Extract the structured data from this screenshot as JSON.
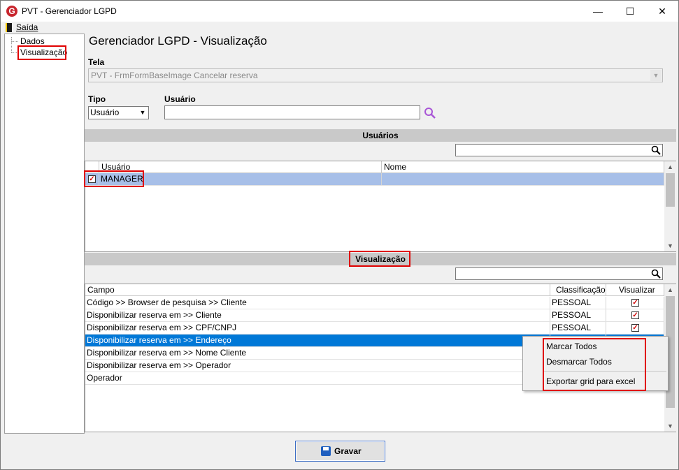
{
  "window": {
    "title": "PVT - Gerenciador LGPD",
    "app_icon": "G",
    "minimize": "—",
    "maximize": "☐",
    "close": "✕"
  },
  "menu": {
    "saida": "Saída"
  },
  "tree": {
    "items": [
      "Dados",
      "Visualização"
    ]
  },
  "heading": "Gerenciador LGPD - Visualização",
  "tela": {
    "label": "Tela",
    "value": "PVT - FrmFormBaseImage Cancelar reserva"
  },
  "tipo": {
    "label": "Tipo",
    "value": "Usuário"
  },
  "usuario": {
    "label": "Usuário",
    "value": ""
  },
  "usuarios_section": {
    "title": "Usuários",
    "search_value": "",
    "columns": [
      "Usuário",
      "Nome"
    ],
    "rows": [
      {
        "checked": true,
        "usuario": "MANAGER",
        "nome": ""
      }
    ]
  },
  "visualizacao_section": {
    "title": "Visualização",
    "search_value": "",
    "columns": [
      "Campo",
      "Classificação",
      "Visualizar"
    ],
    "rows": [
      {
        "campo": "Código >> Browser de pesquisa >> Cliente",
        "classificacao": "PESSOAL",
        "visualizar": true
      },
      {
        "campo": "Disponibilizar reserva em >> Cliente",
        "classificacao": "PESSOAL",
        "visualizar": true
      },
      {
        "campo": "Disponibilizar reserva em >> CPF/CNPJ",
        "classificacao": "PESSOAL",
        "visualizar": true
      },
      {
        "campo": "Disponibilizar reserva em >> Endereço",
        "classificacao": "",
        "visualizar": false
      },
      {
        "campo": "Disponibilizar reserva em >> Nome Cliente",
        "classificacao": "",
        "visualizar": false
      },
      {
        "campo": "Disponibilizar reserva em >> Operador",
        "classificacao": "",
        "visualizar": false
      },
      {
        "campo": "Operador",
        "classificacao": "",
        "visualizar": false
      }
    ]
  },
  "context_menu": {
    "items": [
      "Marcar Todos",
      "Desmarcar Todos",
      "Exportar grid para excel"
    ]
  },
  "gravar_button": "Gravar",
  "colors": {
    "highlight_red": "#e00000",
    "selected_row": "#0078d7",
    "manager_row": "#a7bfe8",
    "section_bar": "#c9c9c9"
  }
}
